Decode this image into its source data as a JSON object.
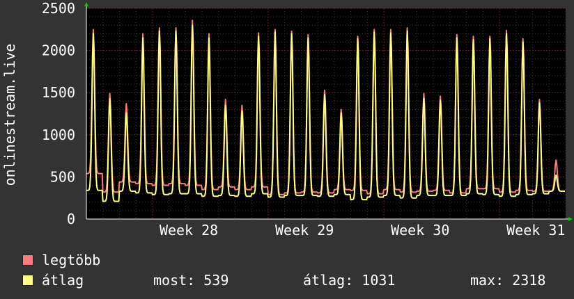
{
  "chart_data": {
    "type": "line",
    "ylabel": "onlinestream.live",
    "ylim": [
      0,
      2500
    ],
    "yticks": [
      0,
      500,
      1000,
      1500,
      2000,
      2500
    ],
    "xticks": [
      "Week 28",
      "Week 29",
      "Week 30",
      "Week 31"
    ],
    "grid": true,
    "days": 29,
    "series": [
      {
        "name": "legtöbb",
        "color": "#ff7b7b",
        "daily_peaks": [
          2250,
          1490,
          1370,
          2200,
          2270,
          2270,
          2360,
          2200,
          1420,
          1350,
          2210,
          2250,
          2230,
          2190,
          1530,
          1300,
          2170,
          2250,
          2250,
          2270,
          1490,
          1460,
          2190,
          2170,
          2170,
          2240,
          2140,
          1420,
          700
        ],
        "daily_troughs": [
          540,
          320,
          440,
          420,
          400,
          420,
          400,
          350,
          380,
          350,
          380,
          290,
          310,
          320,
          310,
          350,
          340,
          300,
          350,
          320,
          330,
          340,
          310,
          360,
          360,
          320,
          340,
          330,
          330
        ]
      },
      {
        "name": "átlag",
        "color": "#ffff80",
        "daily_peaks": [
          2200,
          1430,
          1260,
          2150,
          2230,
          2230,
          2300,
          2150,
          1350,
          1280,
          2170,
          2220,
          2200,
          2150,
          1480,
          1260,
          2140,
          2220,
          2210,
          2230,
          1430,
          1410,
          2150,
          2130,
          2140,
          2200,
          2100,
          1380,
          520
        ],
        "daily_troughs": [
          340,
          210,
          330,
          310,
          290,
          300,
          300,
          270,
          280,
          270,
          300,
          260,
          280,
          280,
          270,
          290,
          230,
          260,
          280,
          250,
          280,
          280,
          280,
          300,
          290,
          270,
          290,
          300,
          330
        ]
      }
    ],
    "legend": {
      "placement": "bottom-left"
    }
  },
  "legend": {
    "max_label": "legtöbb",
    "avg_label": "átlag",
    "max_color": "#ff7b7b",
    "avg_color": "#ffff80"
  },
  "stats": {
    "now": "most: 539",
    "avg": "átlag: 1031",
    "max": "max: 2318"
  }
}
